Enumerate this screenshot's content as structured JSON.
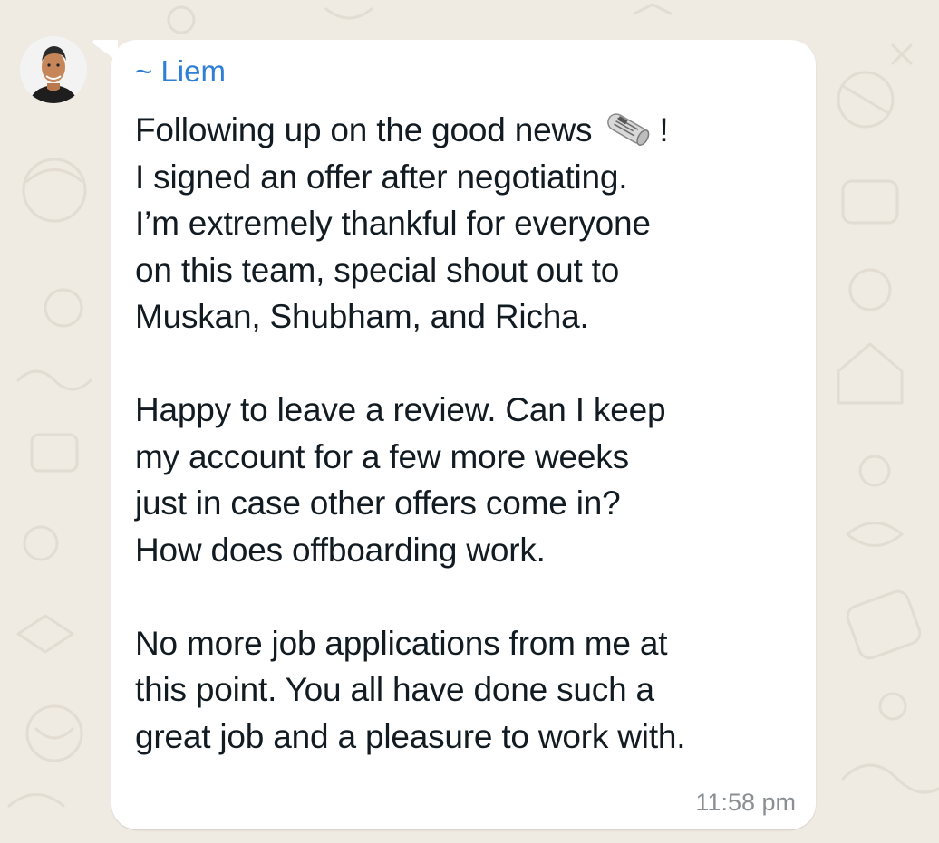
{
  "chat": {
    "background_color": "#efeae2",
    "bubble_color": "#ffffff",
    "accent_color": "#2f7fd6"
  },
  "message": {
    "sender": "~ Liem",
    "line1_before_emoji": "Following up on the good news",
    "emoji_icon": "rolled-up-newspaper-icon",
    "line1_after_emoji": "!",
    "paragraph1_lines": [
      "I signed an offer after negotiating.",
      "I’m extremely thankful for everyone",
      "on this team, special shout out to",
      "Muskan, Shubham, and Richa."
    ],
    "paragraph2_lines": [
      "Happy to leave a review. Can I keep",
      "my account for a few more weeks",
      "just in case other offers come in?",
      "How does offboarding work."
    ],
    "paragraph3_lines": [
      "No more job applications from me at",
      "this point. You all have done such a",
      "great job and a pleasure to work with."
    ],
    "timestamp": "11:58 pm"
  }
}
